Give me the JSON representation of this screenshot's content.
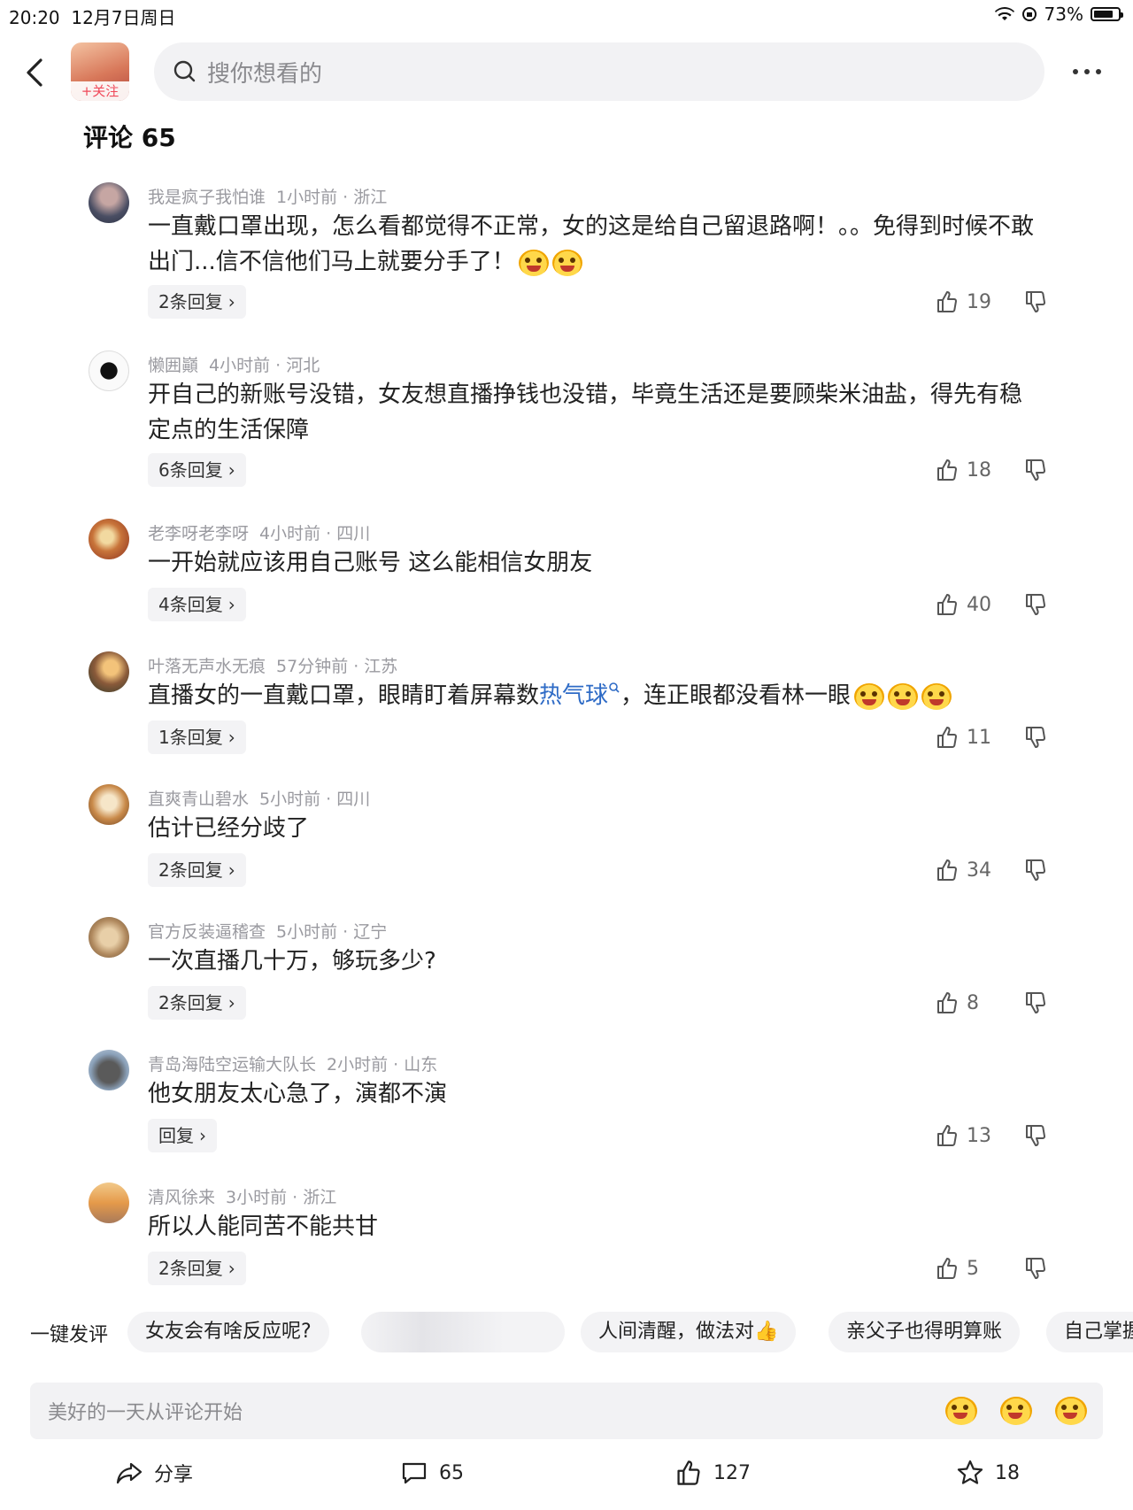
{
  "status_bar": {
    "time": "20:20",
    "date": "12月7日周日",
    "battery": "73%"
  },
  "header": {
    "follow_label": "+关注",
    "search_placeholder": "搜你想看的"
  },
  "comments_header": {
    "title": "评论 65"
  },
  "comments": [
    {
      "user": "我是疯子我怕谁",
      "time": "1小时前 · 浙江",
      "text": "一直戴口罩出现，怎么看都觉得不正常，女的这是给自己留退路啊！。。免得到时候不敢出门...信不信他们马上就要分手了！",
      "replies": "2条回复",
      "likes": "19"
    },
    {
      "user": "懒囲巓",
      "time": "4小时前 · 河北",
      "text": "开自己的新账号没错，女友想直播挣钱也没错，毕竟生活还是要顾柴米油盐，得先有稳定点的生活保障",
      "replies": "6条回复",
      "likes": "18"
    },
    {
      "user": "老李呀老李呀",
      "time": "4小时前 · 四川",
      "text": "一开始就应该用自己账号 这么能相信女朋友",
      "replies": "4条回复",
      "likes": "40"
    },
    {
      "user": "叶落无声水无痕",
      "time": "57分钟前 · 江苏",
      "text_before": "直播女的一直戴口罩，眼睛盯着屏幕数",
      "text_link": "热气球",
      "text_after": "，连正眼都没看林一眼",
      "replies": "1条回复",
      "likes": "11"
    },
    {
      "user": "直爽青山碧水",
      "time": "5小时前 · 四川",
      "text": "估计已经分歧了",
      "replies": "2条回复",
      "likes": "34"
    },
    {
      "user": "官方反装逼稽查",
      "time": "5小时前 · 辽宁",
      "text": "一次直播几十万，够玩多少?",
      "replies": "2条回复",
      "likes": "8"
    },
    {
      "user": "青岛海陆空运输大队长",
      "time": "2小时前 · 山东",
      "text": "他女朋友太心急了，演都不演",
      "replies": "回复",
      "likes": "13"
    },
    {
      "user": "清风徐来",
      "time": "3小时前 · 浙江",
      "text": "所以人能同苦不能共甘",
      "replies": "2条回复",
      "likes": "5"
    }
  ],
  "quick_comments": {
    "label": "一键发评",
    "chips": [
      "女友会有啥反应呢?",
      "",
      "人间清醒，做法对👍",
      "亲父子也得明算账",
      "自己掌握"
    ]
  },
  "input": {
    "placeholder": "美好的一天从评论开始"
  },
  "actions": {
    "share": "分享",
    "comments": "65",
    "likes": "127",
    "favorites": "18"
  },
  "colors": {
    "link": "#2e6bc6",
    "follow": "#f04a5a",
    "meta": "#9a9aa0"
  }
}
